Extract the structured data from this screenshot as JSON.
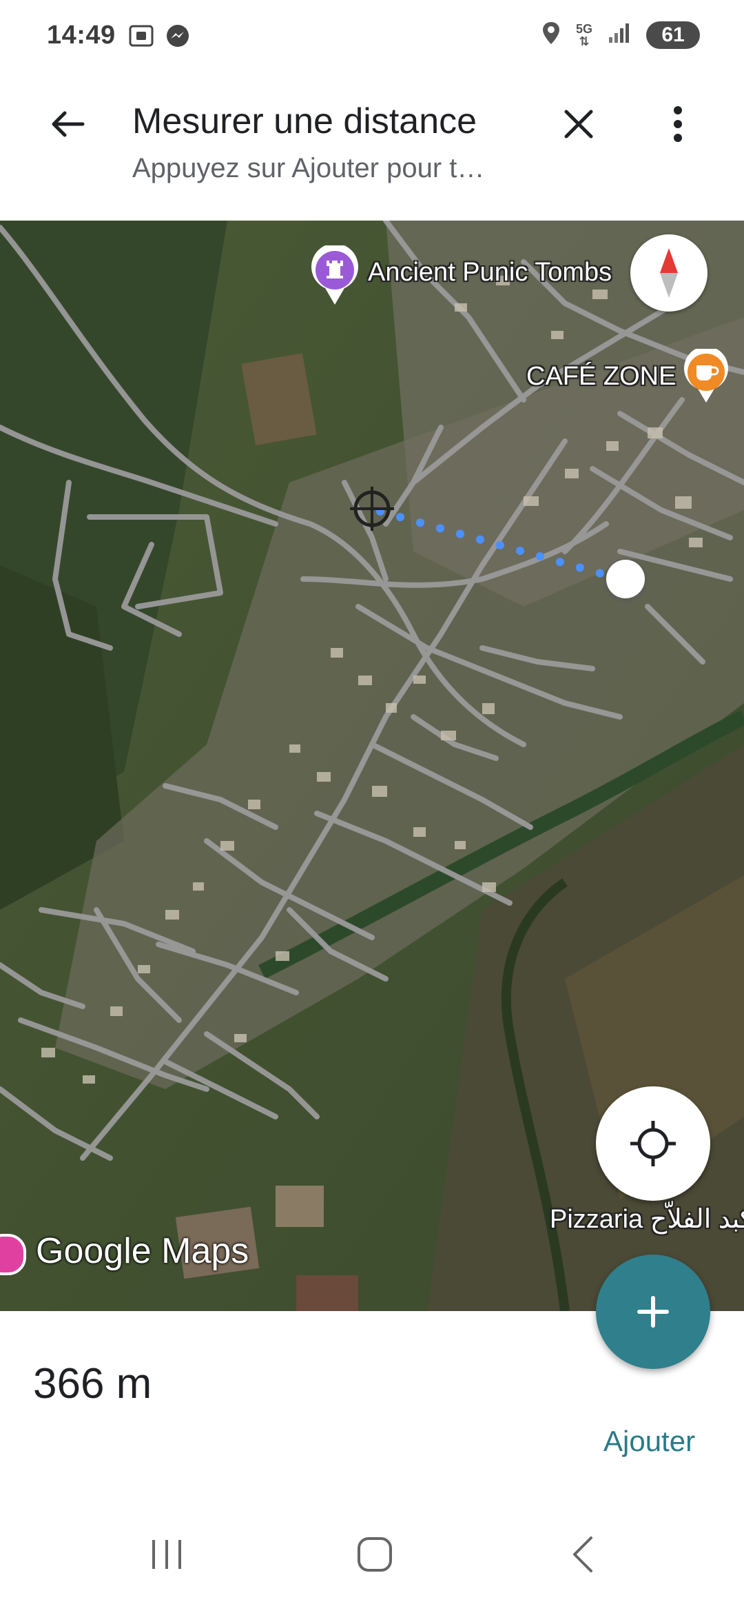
{
  "status_bar": {
    "time": "14:49",
    "network": "5G",
    "battery": "61",
    "icons": [
      "screenshot-icon",
      "messenger-icon",
      "location-icon",
      "network-5g-icon",
      "signal-icon",
      "battery-icon"
    ]
  },
  "header": {
    "title": "Mesurer une distance",
    "subtitle": "Appuyez sur Ajouter pour t…"
  },
  "map": {
    "pois": [
      {
        "label": "Ancient Punic Tombs",
        "icon": "monument-icon",
        "color": "#9a5ad8"
      },
      {
        "label": "CAFÉ ZONE",
        "icon": "coffee-cup-icon",
        "color": "#f08a24"
      },
      {
        "label": "Pizzaria ﻛﺒﺪ ﺍﻟﻔﻼّﺡ",
        "icon": "",
        "color": ""
      }
    ],
    "attribution": "Google Maps",
    "measure_line_color": "#4a90ff"
  },
  "bottom_sheet": {
    "distance": "366 m",
    "add_label": "Ajouter"
  },
  "colors": {
    "accent": "#2b7a86",
    "fab": "#2f7f8c",
    "compass_red": "#e53935"
  }
}
